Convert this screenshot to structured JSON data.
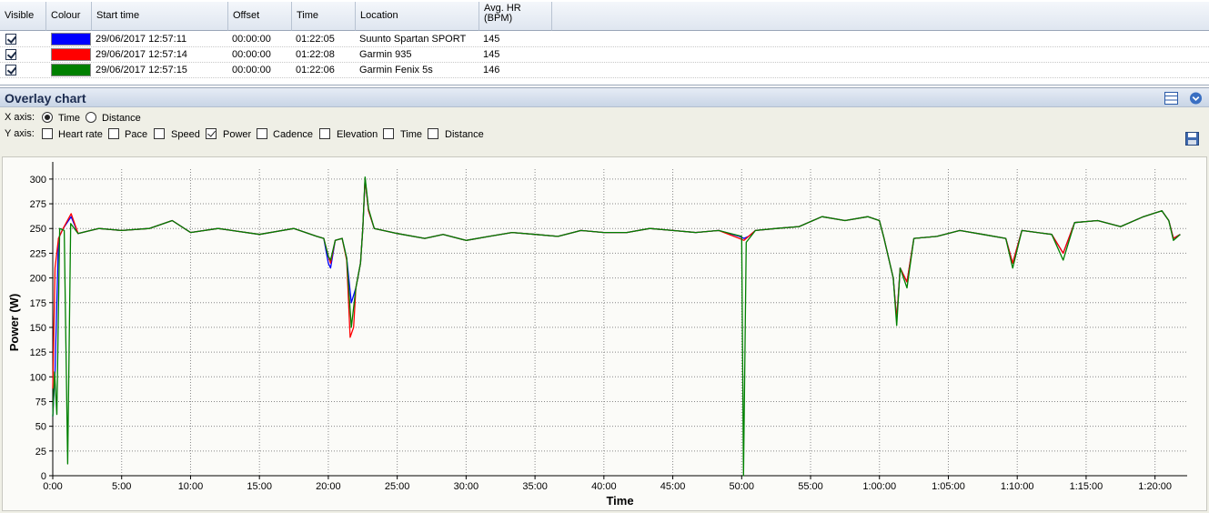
{
  "table": {
    "headers": {
      "visible": "Visible",
      "colour": "Colour",
      "start_time": "Start time",
      "offset": "Offset",
      "time": "Time",
      "location": "Location",
      "avg_hr": "Avg. HR (BPM)"
    },
    "rows": [
      {
        "visible": true,
        "colour": "#0000ff",
        "start_time": "29/06/2017 12:57:11",
        "offset": "00:00:00",
        "time": "01:22:05",
        "location": "Suunto Spartan SPORT",
        "avg_hr": "145"
      },
      {
        "visible": true,
        "colour": "#ff0000",
        "start_time": "29/06/2017 12:57:14",
        "offset": "00:00:00",
        "time": "01:22:08",
        "location": "Garmin 935",
        "avg_hr": "145"
      },
      {
        "visible": true,
        "colour": "#008000",
        "start_time": "29/06/2017 12:57:15",
        "offset": "00:00:00",
        "time": "01:22:06",
        "location": "Garmin Fenix 5s",
        "avg_hr": "146"
      }
    ]
  },
  "panel": {
    "title": "Overlay chart",
    "x_axis_label": "X axis:",
    "x_options": [
      {
        "label": "Time",
        "selected": true
      },
      {
        "label": "Distance",
        "selected": false
      }
    ],
    "y_axis_label": "Y axis:",
    "y_options": [
      {
        "label": "Heart rate",
        "checked": false
      },
      {
        "label": "Pace",
        "checked": false
      },
      {
        "label": "Speed",
        "checked": false
      },
      {
        "label": "Power",
        "checked": true
      },
      {
        "label": "Cadence",
        "checked": false
      },
      {
        "label": "Elevation",
        "checked": false
      },
      {
        "label": "Time",
        "checked": false
      },
      {
        "label": "Distance",
        "checked": false
      }
    ],
    "icons": [
      "table-layout-icon",
      "collapse-chevron-icon",
      "save-disk-icon"
    ]
  },
  "chart_data": {
    "type": "line",
    "xlabel": "Time",
    "ylabel": "Power (W)",
    "ylim": [
      0,
      310
    ],
    "xlim": [
      0,
      4940
    ],
    "y_ticks": [
      0,
      25,
      50,
      75,
      100,
      125,
      150,
      175,
      200,
      225,
      250,
      275,
      300
    ],
    "x_ticks": [
      {
        "value": 0,
        "label": "0:00"
      },
      {
        "value": 300,
        "label": "5:00"
      },
      {
        "value": 600,
        "label": "10:00"
      },
      {
        "value": 900,
        "label": "15:00"
      },
      {
        "value": 1200,
        "label": "20:00"
      },
      {
        "value": 1500,
        "label": "25:00"
      },
      {
        "value": 1800,
        "label": "30:00"
      },
      {
        "value": 2100,
        "label": "35:00"
      },
      {
        "value": 2400,
        "label": "40:00"
      },
      {
        "value": 2700,
        "label": "45:00"
      },
      {
        "value": 3000,
        "label": "50:00"
      },
      {
        "value": 3300,
        "label": "55:00"
      },
      {
        "value": 3600,
        "label": "1:00:00"
      },
      {
        "value": 3900,
        "label": "1:05:00"
      },
      {
        "value": 4200,
        "label": "1:10:00"
      },
      {
        "value": 4500,
        "label": "1:15:00"
      },
      {
        "value": 4800,
        "label": "1:20:00"
      }
    ],
    "grid": true,
    "series": [
      {
        "color": "#0000ff",
        "points": [
          [
            0,
            60
          ],
          [
            10,
            105
          ],
          [
            25,
            240
          ],
          [
            45,
            250
          ],
          [
            80,
            262
          ],
          [
            110,
            245
          ],
          [
            200,
            250
          ],
          [
            300,
            248
          ],
          [
            420,
            250
          ],
          [
            520,
            258
          ],
          [
            600,
            246
          ],
          [
            720,
            250
          ],
          [
            900,
            244
          ],
          [
            1050,
            250
          ],
          [
            1150,
            242
          ],
          [
            1180,
            240
          ],
          [
            1200,
            215
          ],
          [
            1210,
            210
          ],
          [
            1230,
            238
          ],
          [
            1260,
            240
          ],
          [
            1280,
            220
          ],
          [
            1300,
            175
          ],
          [
            1320,
            190
          ],
          [
            1340,
            215
          ],
          [
            1350,
            250
          ],
          [
            1360,
            300
          ],
          [
            1375,
            268
          ],
          [
            1400,
            250
          ],
          [
            1500,
            245
          ],
          [
            1620,
            240
          ],
          [
            1700,
            244
          ],
          [
            1800,
            238
          ],
          [
            1900,
            242
          ],
          [
            2000,
            246
          ],
          [
            2100,
            244
          ],
          [
            2200,
            242
          ],
          [
            2300,
            248
          ],
          [
            2400,
            246
          ],
          [
            2500,
            246
          ],
          [
            2600,
            250
          ],
          [
            2700,
            248
          ],
          [
            2800,
            246
          ],
          [
            2900,
            248
          ],
          [
            2990,
            242
          ],
          [
            3010,
            240
          ],
          [
            3030,
            242
          ],
          [
            3060,
            248
          ],
          [
            3150,
            250
          ],
          [
            3250,
            252
          ],
          [
            3350,
            262
          ],
          [
            3450,
            258
          ],
          [
            3550,
            262
          ],
          [
            3600,
            258
          ],
          [
            3620,
            240
          ],
          [
            3660,
            200
          ],
          [
            3675,
            158
          ],
          [
            3690,
            210
          ],
          [
            3720,
            196
          ],
          [
            3750,
            240
          ],
          [
            3850,
            242
          ],
          [
            3950,
            248
          ],
          [
            4050,
            244
          ],
          [
            4150,
            240
          ],
          [
            4180,
            215
          ],
          [
            4220,
            248
          ],
          [
            4350,
            244
          ],
          [
            4400,
            225
          ],
          [
            4450,
            256
          ],
          [
            4550,
            258
          ],
          [
            4650,
            252
          ],
          [
            4750,
            262
          ],
          [
            4830,
            268
          ],
          [
            4860,
            258
          ],
          [
            4880,
            240
          ],
          [
            4910,
            244
          ]
        ]
      },
      {
        "color": "#ff0000",
        "points": [
          [
            0,
            88
          ],
          [
            10,
            210
          ],
          [
            25,
            240
          ],
          [
            45,
            250
          ],
          [
            80,
            265
          ],
          [
            110,
            245
          ],
          [
            200,
            250
          ],
          [
            300,
            248
          ],
          [
            420,
            250
          ],
          [
            520,
            258
          ],
          [
            600,
            246
          ],
          [
            720,
            250
          ],
          [
            900,
            244
          ],
          [
            1050,
            250
          ],
          [
            1150,
            242
          ],
          [
            1180,
            240
          ],
          [
            1200,
            222
          ],
          [
            1210,
            215
          ],
          [
            1230,
            238
          ],
          [
            1260,
            240
          ],
          [
            1280,
            218
          ],
          [
            1295,
            140
          ],
          [
            1310,
            150
          ],
          [
            1320,
            190
          ],
          [
            1340,
            215
          ],
          [
            1350,
            250
          ],
          [
            1360,
            300
          ],
          [
            1375,
            268
          ],
          [
            1400,
            250
          ],
          [
            1500,
            245
          ],
          [
            1620,
            240
          ],
          [
            1700,
            244
          ],
          [
            1800,
            238
          ],
          [
            1900,
            242
          ],
          [
            2000,
            246
          ],
          [
            2100,
            244
          ],
          [
            2200,
            242
          ],
          [
            2300,
            248
          ],
          [
            2400,
            246
          ],
          [
            2500,
            246
          ],
          [
            2600,
            250
          ],
          [
            2700,
            248
          ],
          [
            2800,
            246
          ],
          [
            2900,
            248
          ],
          [
            2990,
            240
          ],
          [
            3010,
            238
          ],
          [
            3030,
            242
          ],
          [
            3060,
            248
          ],
          [
            3150,
            250
          ],
          [
            3250,
            252
          ],
          [
            3350,
            262
          ],
          [
            3450,
            258
          ],
          [
            3550,
            262
          ],
          [
            3600,
            258
          ],
          [
            3620,
            240
          ],
          [
            3660,
            200
          ],
          [
            3675,
            158
          ],
          [
            3690,
            210
          ],
          [
            3720,
            196
          ],
          [
            3750,
            240
          ],
          [
            3850,
            242
          ],
          [
            3950,
            248
          ],
          [
            4050,
            244
          ],
          [
            4150,
            240
          ],
          [
            4180,
            215
          ],
          [
            4220,
            248
          ],
          [
            4350,
            244
          ],
          [
            4400,
            225
          ],
          [
            4450,
            256
          ],
          [
            4550,
            258
          ],
          [
            4650,
            252
          ],
          [
            4750,
            262
          ],
          [
            4830,
            268
          ],
          [
            4860,
            258
          ],
          [
            4880,
            240
          ],
          [
            4910,
            244
          ]
        ]
      },
      {
        "color": "#008000",
        "points": [
          [
            0,
            60
          ],
          [
            8,
            105
          ],
          [
            18,
            62
          ],
          [
            30,
            250
          ],
          [
            50,
            248
          ],
          [
            65,
            12
          ],
          [
            78,
            255
          ],
          [
            110,
            245
          ],
          [
            200,
            250
          ],
          [
            300,
            248
          ],
          [
            420,
            250
          ],
          [
            520,
            258
          ],
          [
            600,
            246
          ],
          [
            720,
            250
          ],
          [
            900,
            244
          ],
          [
            1050,
            250
          ],
          [
            1150,
            242
          ],
          [
            1180,
            240
          ],
          [
            1200,
            222
          ],
          [
            1210,
            218
          ],
          [
            1230,
            238
          ],
          [
            1260,
            240
          ],
          [
            1280,
            220
          ],
          [
            1300,
            150
          ],
          [
            1320,
            190
          ],
          [
            1340,
            215
          ],
          [
            1350,
            250
          ],
          [
            1360,
            302
          ],
          [
            1375,
            270
          ],
          [
            1400,
            250
          ],
          [
            1500,
            245
          ],
          [
            1620,
            240
          ],
          [
            1700,
            244
          ],
          [
            1800,
            238
          ],
          [
            1900,
            242
          ],
          [
            2000,
            246
          ],
          [
            2100,
            244
          ],
          [
            2200,
            242
          ],
          [
            2300,
            248
          ],
          [
            2400,
            246
          ],
          [
            2500,
            246
          ],
          [
            2600,
            250
          ],
          [
            2700,
            248
          ],
          [
            2800,
            246
          ],
          [
            2900,
            248
          ],
          [
            3000,
            242
          ],
          [
            3008,
            0
          ],
          [
            3020,
            236
          ],
          [
            3060,
            248
          ],
          [
            3150,
            250
          ],
          [
            3250,
            252
          ],
          [
            3350,
            262
          ],
          [
            3450,
            258
          ],
          [
            3550,
            262
          ],
          [
            3600,
            258
          ],
          [
            3620,
            240
          ],
          [
            3660,
            200
          ],
          [
            3675,
            152
          ],
          [
            3690,
            210
          ],
          [
            3720,
            190
          ],
          [
            3750,
            240
          ],
          [
            3850,
            242
          ],
          [
            3950,
            248
          ],
          [
            4050,
            244
          ],
          [
            4150,
            240
          ],
          [
            4180,
            210
          ],
          [
            4220,
            248
          ],
          [
            4350,
            244
          ],
          [
            4400,
            218
          ],
          [
            4450,
            256
          ],
          [
            4550,
            258
          ],
          [
            4650,
            252
          ],
          [
            4750,
            262
          ],
          [
            4830,
            268
          ],
          [
            4860,
            258
          ],
          [
            4880,
            238
          ],
          [
            4910,
            244
          ]
        ]
      }
    ]
  }
}
